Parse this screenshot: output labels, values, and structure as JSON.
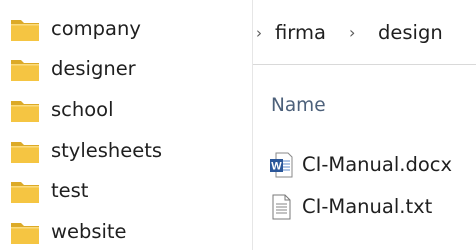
{
  "navigation": {
    "folders": [
      {
        "label": "company"
      },
      {
        "label": "designer"
      },
      {
        "label": "school"
      },
      {
        "label": "stylesheets"
      },
      {
        "label": "test"
      },
      {
        "label": "website"
      }
    ]
  },
  "address_bar": {
    "breadcrumbs": [
      {
        "label": "firma"
      },
      {
        "label": "design"
      }
    ]
  },
  "file_list": {
    "column_header": "Name",
    "files": [
      {
        "name": "CI-Manual.docx",
        "icon": "word-document-icon"
      },
      {
        "name": "CI-Manual.txt",
        "icon": "text-document-icon"
      }
    ]
  },
  "colors": {
    "folder": "#f5c542",
    "folder_dark": "#dcaa27",
    "header_text": "#4c607a",
    "word_blue": "#2b579a"
  }
}
